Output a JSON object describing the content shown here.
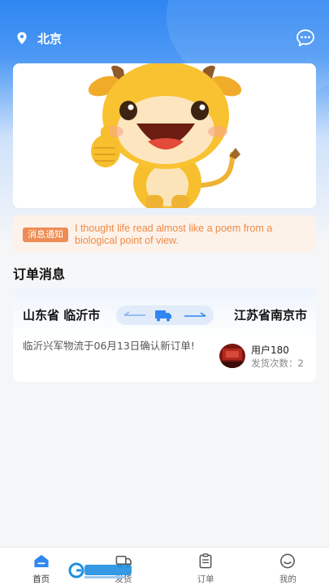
{
  "location": {
    "city": "北京",
    "icon": "location-pin-icon"
  },
  "header": {
    "message_icon": "chat-bubble-icon"
  },
  "notice": {
    "tag": "消息通知",
    "text": "I thought life read almost like a poem from a biological point of view."
  },
  "section": {
    "title": "订单消息"
  },
  "order": {
    "from": "山东省 临沂市",
    "to": "江苏省南京市",
    "description": "临沂兴军物流于06月13日确认新订单!",
    "user_name": "用户180",
    "ship_count": "发货次数：2"
  },
  "tabs": [
    {
      "label": "首页",
      "icon": "home-icon",
      "active": true
    },
    {
      "label": "发货",
      "icon": "truck-icon",
      "active": false
    },
    {
      "label": "订单",
      "icon": "clipboard-icon",
      "active": false
    },
    {
      "label": "我的",
      "icon": "smile-face-icon",
      "active": false
    }
  ],
  "colors": {
    "primary": "#2f86f2",
    "notice_accent": "#ec8d55",
    "notice_text": "#ef8a45"
  }
}
